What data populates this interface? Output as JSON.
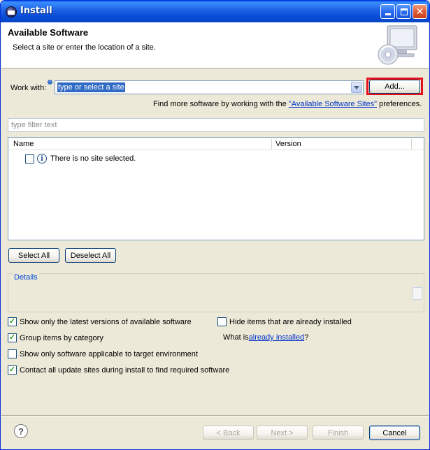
{
  "window": {
    "title": "Install"
  },
  "header": {
    "title": "Available Software",
    "description": "Select a site or enter the location of a site."
  },
  "work_with": {
    "label": "Work with:",
    "value": "type or select a site",
    "add_button": "Add...",
    "find_more_prefix": "Find more software by working with the ",
    "find_more_link": "\"Available Software Sites\"",
    "find_more_suffix": " preferences."
  },
  "filter": {
    "placeholder": "type filter text"
  },
  "table": {
    "columns": [
      "Name",
      "Version"
    ],
    "rows": [
      {
        "text": "There is no site selected.",
        "checked": false,
        "icon": "info-icon"
      }
    ]
  },
  "selection_buttons": {
    "select_all": "Select All",
    "deselect_all": "Deselect All"
  },
  "details": {
    "label": "Details"
  },
  "options": {
    "show_latest": {
      "label": "Show only the latest versions of available software",
      "checked": true
    },
    "group_by_category": {
      "label": "Group items by category",
      "checked": true
    },
    "applicable_only": {
      "label": "Show only software applicable to target environment",
      "checked": false
    },
    "contact_all": {
      "label": "Contact all update sites during install to find required software",
      "checked": true
    },
    "hide_installed": {
      "label": "Hide items that are already installed",
      "checked": false
    },
    "what_is_prefix": "What is ",
    "what_is_link": "already installed",
    "what_is_suffix": "?"
  },
  "footer": {
    "help": "?",
    "back": "< Back",
    "next": "Next >",
    "finish": "Finish",
    "cancel": "Cancel"
  },
  "colors": {
    "titlebar": "#0A4DD8",
    "highlight": "#E8101A",
    "link": "#0033CC",
    "selection": "#316AC5",
    "background": "#ECE9D8"
  }
}
